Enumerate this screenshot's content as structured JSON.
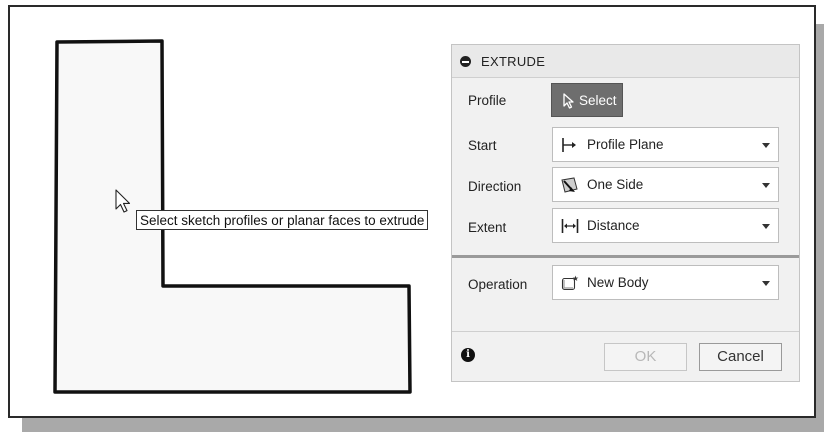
{
  "tooltip": {
    "text": "Select sketch profiles or planar faces to extrude"
  },
  "panel": {
    "title": "EXTRUDE",
    "rows": {
      "profile": {
        "label": "Profile",
        "button_label": "Select",
        "icon": "cursor-icon"
      },
      "start": {
        "label": "Start",
        "value": "Profile Plane",
        "icon": "profile-plane-icon"
      },
      "direction": {
        "label": "Direction",
        "value": "One Side",
        "icon": "one-side-icon"
      },
      "extent": {
        "label": "Extent",
        "value": "Distance",
        "icon": "distance-icon"
      },
      "operation": {
        "label": "Operation",
        "value": "New Body",
        "icon": "new-body-icon"
      }
    },
    "footer": {
      "ok_label": "OK",
      "cancel_label": "Cancel",
      "info_icon": "info-icon"
    }
  },
  "colors": {
    "select_button": "#6e6e6e",
    "panel_bg": "#f1f1f1",
    "ok_disabled_text": "#b8b8b8"
  }
}
